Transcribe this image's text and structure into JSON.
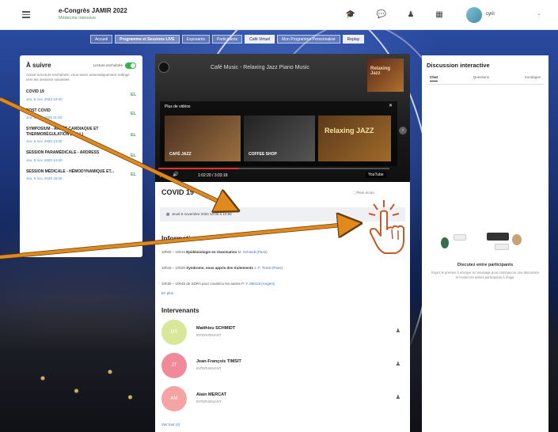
{
  "header": {
    "title": "e-Congrès JAMIR 2022",
    "subtitle": "Médecine intensive"
  },
  "user": {
    "name": "cyril"
  },
  "nav": {
    "tabs": [
      {
        "label": "Accueil"
      },
      {
        "label": "Programme et Sessions LIVE"
      },
      {
        "label": "Exposants"
      },
      {
        "label": "Participants"
      },
      {
        "label": "Café Virtuel"
      },
      {
        "label": "Mon Programme Personnalisé"
      },
      {
        "label": "Replay"
      }
    ]
  },
  "left_panel": {
    "title": "À suivre",
    "toggle_label": "Lecture enchaînée",
    "description": "Active la lecture enchaînée, vous serez automatiquement redirigé vers les sessions suivantes.",
    "sessions": [
      {
        "name": "COVID 19",
        "date": "Jeu. 5 nov. 2020 10:00",
        "badge": "EL"
      },
      {
        "name": "POST COVID",
        "date": "Jeu. 5 nov. 2020 11:00",
        "badge": "EL"
      },
      {
        "name": "SYMPOSIUM - ARRÊT CARDIAQUE ET THERMORÉGULATION (ZOLL)",
        "date": "Jeu. 5 nov. 2020 13:00",
        "badge": "EL"
      },
      {
        "name": "SESSION PARAMÉDICALE - ARDRESS",
        "date": "Jeu. 5 nov. 2020 14:00",
        "badge": "EL"
      },
      {
        "name": "SESSION MÉDICALE - HÉMODYNAMIQUE ET...",
        "date": "Jeu. 5 nov. 2020 15:00",
        "badge": "EL"
      }
    ]
  },
  "video": {
    "title": "Café Music - Relaxing Jazz Piano Music",
    "poster_text": "Relaxing Jazz",
    "suggest_label": "Plus de vidéos",
    "thumbs": [
      {
        "label": "CAFÉ JAZZ",
        "big": ""
      },
      {
        "label": "COFFEE SHOP",
        "big": ""
      },
      {
        "label": "",
        "big": "Relaxing JAZZ"
      }
    ],
    "time": "1:02:20 / 3:03:18",
    "progress_pct": 35,
    "youtube": "YouTube"
  },
  "session": {
    "title": "COVID 19",
    "fullscreen": "Plein écran",
    "date": "Jeudi 5 novembre 2020 10:00 à 10:58",
    "info_title": "Informations",
    "info_lines": [
      {
        "time": "10h00 – 10h15",
        "text": "Épidémiologie en réanimation",
        "speaker": "M. Schmidt (Paris)"
      },
      {
        "time": "10h15 – 10h30",
        "text": "Syndrome, nous appris des traitements",
        "speaker": "J.-F. Timsit (Paris)"
      },
      {
        "time": "10h30 – 10h45",
        "text": "de SDRA pour covaincu les autres",
        "speaker": "P.-Y. Mercat (Angers)"
      }
    ],
    "more_link": "En plus",
    "speakers_title": "Intervenants",
    "speakers": [
      {
        "initials": "MS",
        "name": "Matthieu SCHMIDT",
        "role": "INTERVENANT",
        "color": "#d9e79a"
      },
      {
        "initials": "JT",
        "name": "Jean-François TIMSIT",
        "role": "INTERVENANT",
        "color": "#f08a9a"
      },
      {
        "initials": "AM",
        "name": "Alain MERCAT",
        "role": "INTERVENANT",
        "color": "#f5a3a3"
      }
    ],
    "see_all": "Voir tout (4)"
  },
  "chat": {
    "title": "Discussion interactive",
    "tabs": [
      {
        "label": "Chat",
        "active": true
      },
      {
        "label": "Questions",
        "active": false
      },
      {
        "label": "Sondages",
        "active": false
      }
    ],
    "empty_title": "Discutez entre participants",
    "empty_desc": "Soyez le premier à envoyer un message pour commencer une discussion et invitez les autres participants à réagir."
  },
  "colors": {
    "accent": "#37b24d",
    "arrow": "#e08a1e",
    "link": "#3a6fc4"
  }
}
